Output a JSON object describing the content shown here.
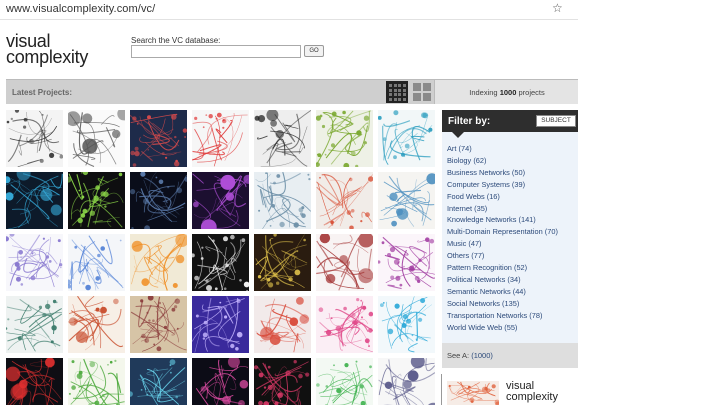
{
  "browser": {
    "url": "www.visualcomplexity.com/vc/",
    "bookmark_icon": "star-icon"
  },
  "header": {
    "logo_line1": "visual",
    "logo_line2": "complexity",
    "search_label": "Search the VC database:",
    "search_value": "",
    "go_label": "GO"
  },
  "toolbar": {
    "title": "Latest Projects:",
    "view_small_icon": "small-grid-icon",
    "view_large_icon": "large-grid-icon",
    "indexing_prefix": "Indexing ",
    "indexing_count": "1000",
    "indexing_suffix": " projects"
  },
  "filter": {
    "title": "Filter by:",
    "selector": "SUBJECT",
    "items": [
      {
        "label": "Art",
        "count": "(74)"
      },
      {
        "label": "Biology",
        "count": "(62)"
      },
      {
        "label": "Business Networks",
        "count": "(50)"
      },
      {
        "label": "Computer Systems",
        "count": "(39)"
      },
      {
        "label": "Food Webs",
        "count": "(16)"
      },
      {
        "label": "Internet",
        "count": "(35)"
      },
      {
        "label": "Knowledge Networks",
        "count": "(141)"
      },
      {
        "label": "Multi-Domain Representation",
        "count": "(70)"
      },
      {
        "label": "Music",
        "count": "(47)"
      },
      {
        "label": "Others",
        "count": "(77)"
      },
      {
        "label": "Pattern Recognition",
        "count": "(52)"
      },
      {
        "label": "Political Networks",
        "count": "(34)"
      },
      {
        "label": "Semantic Networks",
        "count": "(44)"
      },
      {
        "label": "Social Networks",
        "count": "(135)"
      },
      {
        "label": "Transportation Networks",
        "count": "(78)"
      },
      {
        "label": "World Wide Web",
        "count": "(55)"
      }
    ],
    "see_all_label": "See A",
    "see_all_count": "(1000)"
  },
  "footer": {
    "logo_line1": "visual",
    "logo_line2": "complexity"
  },
  "colors": {
    "filter_link": "#2c4a7a",
    "filter_header": "#2e2e2e",
    "filter_body": "#edf3fa",
    "toolbar": "#cfcfcf"
  },
  "thumbnails": [
    {
      "bg": "#f4f4f4",
      "fg": "#333333"
    },
    {
      "bg": "#fafafa",
      "fg": "#555555"
    },
    {
      "bg": "#1e2b4a",
      "fg": "#d84b4b"
    },
    {
      "bg": "#f6f6f6",
      "fg": "#e03a3a"
    },
    {
      "bg": "#eeeeee",
      "fg": "#222222"
    },
    {
      "bg": "#eef1e6",
      "fg": "#7aa82f"
    },
    {
      "bg": "#f2f7f8",
      "fg": "#2e9fc0"
    },
    {
      "bg": "#0d1a2a",
      "fg": "#35a9d8"
    },
    {
      "bg": "#0e0e10",
      "fg": "#8bd648"
    },
    {
      "bg": "#0a0d1a",
      "fg": "#5a7aaa"
    },
    {
      "bg": "#1c0f30",
      "fg": "#b04fd9"
    },
    {
      "bg": "#e8eef2",
      "fg": "#6b8ea6"
    },
    {
      "bg": "#f1ece8",
      "fg": "#d9553c"
    },
    {
      "bg": "#f5f4f1",
      "fg": "#4c8fbf"
    },
    {
      "bg": "#f7f7fb",
      "fg": "#8a7ad0"
    },
    {
      "bg": "#f4f6f9",
      "fg": "#5a87d8"
    },
    {
      "bg": "#f1ead6",
      "fg": "#f08a1c"
    },
    {
      "bg": "#121212",
      "fg": "#f0f0f0"
    },
    {
      "bg": "#2a1c10",
      "fg": "#e0c24b"
    },
    {
      "bg": "#f8f3f3",
      "fg": "#a63a3a"
    },
    {
      "bg": "#fbf5fa",
      "fg": "#a03aa0"
    },
    {
      "bg": "#eef2f1",
      "fg": "#3a7a6a"
    },
    {
      "bg": "#f7efe6",
      "fg": "#c94f2f"
    },
    {
      "bg": "#d6c4a6",
      "fg": "#8a3a3a"
    },
    {
      "bg": "#3a2a9c",
      "fg": "#c6b6ff"
    },
    {
      "bg": "#f2eaea",
      "fg": "#d84a3a"
    },
    {
      "bg": "#fbeef5",
      "fg": "#e04a8a"
    },
    {
      "bg": "#f2f8fb",
      "fg": "#2aa8d8"
    },
    {
      "bg": "#0e0e14",
      "fg": "#e23030"
    },
    {
      "bg": "#f4f7ec",
      "fg": "#4aa83a"
    },
    {
      "bg": "#203a5a",
      "fg": "#6ad8f0"
    },
    {
      "bg": "#0c0c16",
      "fg": "#d84aa0"
    },
    {
      "bg": "#101010",
      "fg": "#e03a6a"
    },
    {
      "bg": "#f3f9f3",
      "fg": "#3ab04a"
    },
    {
      "bg": "#f7f7f7",
      "fg": "#5a5a8a"
    }
  ],
  "footer_thumbnail": {
    "bg": "#f6ece6",
    "fg": "#e0603a"
  }
}
